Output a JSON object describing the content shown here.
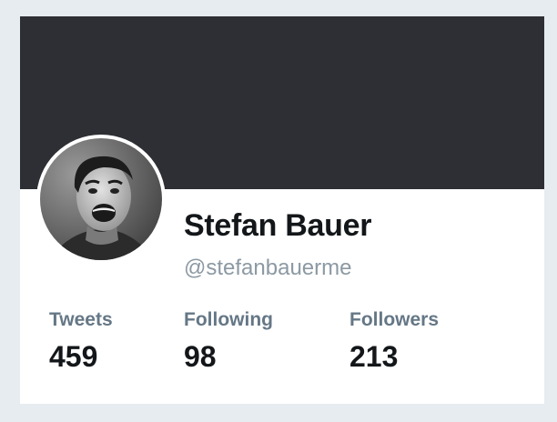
{
  "profile": {
    "name": "Stefan Bauer",
    "handle": "@stefanbauerme"
  },
  "stats": [
    {
      "label": "Tweets",
      "value": "459"
    },
    {
      "label": "Following",
      "value": "98"
    },
    {
      "label": "Followers",
      "value": "213"
    }
  ],
  "colors": {
    "page_background": "#e6ecf0",
    "banner": "#2d2f34",
    "name_text": "#14171a",
    "secondary_text": "#657786"
  }
}
